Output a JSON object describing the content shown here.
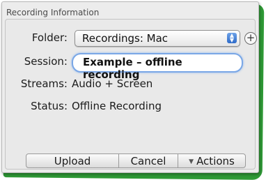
{
  "panel": {
    "title": "Recording Information"
  },
  "folder": {
    "label": "Folder:",
    "selected": "Recordings: Mac"
  },
  "session": {
    "label": "Session:",
    "value": "Example – offline recording"
  },
  "streams": {
    "label": "Streams:",
    "value": "Audio + Screen"
  },
  "status": {
    "label": "Status:",
    "value": "Offline Recording"
  },
  "buttons": {
    "upload": "Upload",
    "cancel": "Cancel",
    "actions": "Actions"
  },
  "icons": {
    "add": "plus-circle-icon",
    "popup_arrows": "up-down-arrows-icon",
    "actions_menu": "triangle-down-icon"
  },
  "colors": {
    "frame": "#2f9a36",
    "focus": "#7aa7e6",
    "stepper": "#2e6bc9"
  }
}
